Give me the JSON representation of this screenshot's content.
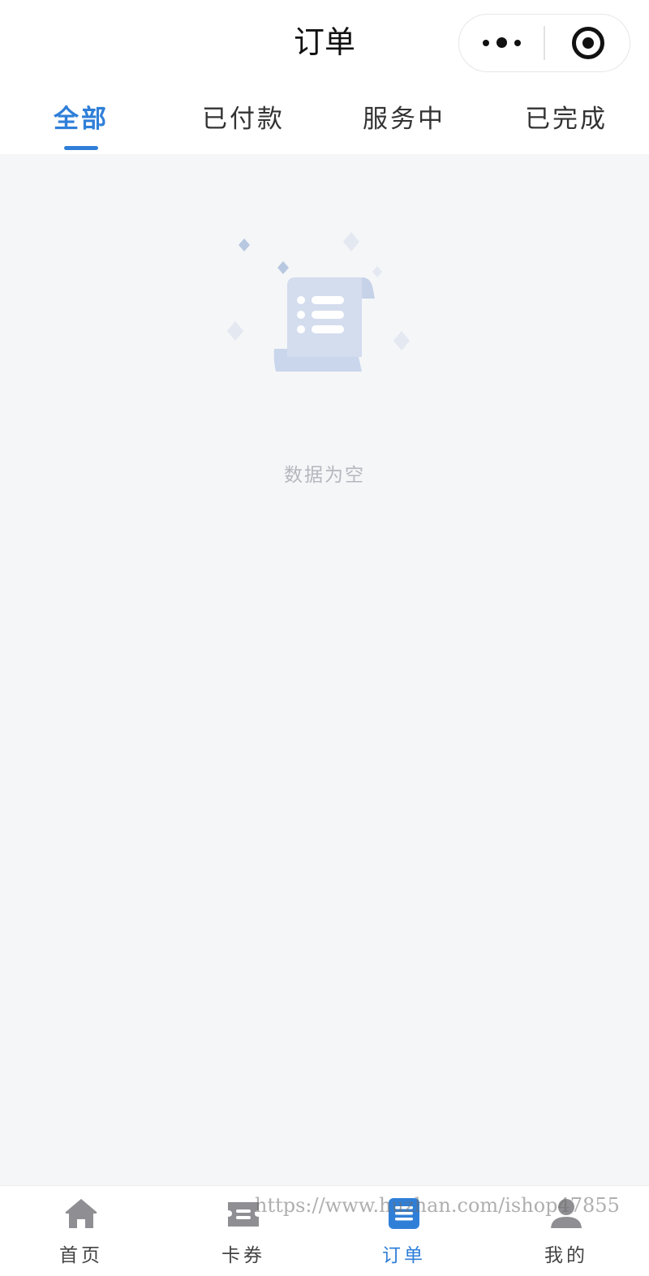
{
  "nav": {
    "title": "订单",
    "more_icon": "more-dots-icon",
    "close_icon": "target-circle-icon"
  },
  "tabs": [
    {
      "label": "全部",
      "active": true
    },
    {
      "label": "已付款",
      "active": false
    },
    {
      "label": "服务中",
      "active": false
    },
    {
      "label": "已完成",
      "active": false
    }
  ],
  "empty": {
    "icon": "empty-list-scroll-icon",
    "text": "数据为空"
  },
  "tabbar": [
    {
      "label": "首页",
      "icon": "home-icon",
      "active": false
    },
    {
      "label": "卡券",
      "icon": "ticket-icon",
      "active": false
    },
    {
      "label": "订单",
      "icon": "order-list-icon",
      "active": true
    },
    {
      "label": "我的",
      "icon": "user-icon",
      "active": false
    }
  ],
  "watermark": "https://www.huzhan.com/ishop47855",
  "colors": {
    "accent": "#2f7fd8",
    "page_bg": "#f5f6f8",
    "inactive_icon": "#8e8e93",
    "empty_text": "#b4b7bd"
  }
}
